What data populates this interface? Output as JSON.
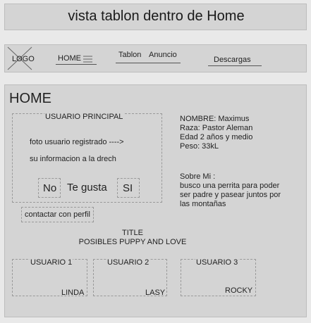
{
  "page_title": "vista tablon dentro  de Home",
  "nav": {
    "logo": "LOGO",
    "home": "HOME",
    "tablon": "Tablon",
    "anuncio": "Anuncio",
    "descargas": "Descargas",
    "menu_icon": "hamburger-menu-icon"
  },
  "main": {
    "heading": "HOME",
    "principal": {
      "label": "USUARIO PRINCIPAL",
      "photo_text": "foto usuario registrado ---->",
      "info_text": "su informacion a la drech",
      "no_label": "No",
      "te_gusta_label": "Te gusta",
      "si_label": "SI"
    },
    "profile": {
      "nombre": "NOMBRE: Maximus",
      "raza": "Raza: Pastor Aleman",
      "edad": "Edad 2 años y medio",
      "peso": "Peso: 33kL"
    },
    "about": {
      "title": "Sobre Mi :",
      "line1": "busco una perrita para poder",
      "line2": "ser padre y pasear juntos por",
      "line3": "las montañas"
    },
    "contact_button": "contactar con perfil",
    "section_title": "TITLE",
    "section_subtitle": "POSIBLES PUPPY AND LOVE",
    "users": [
      {
        "label": "USUARIO 1",
        "name": "LINDA"
      },
      {
        "label": "USUARIO 2",
        "name": "LASY"
      },
      {
        "label": "USUARIO 3",
        "name": "ROCKY"
      }
    ]
  }
}
